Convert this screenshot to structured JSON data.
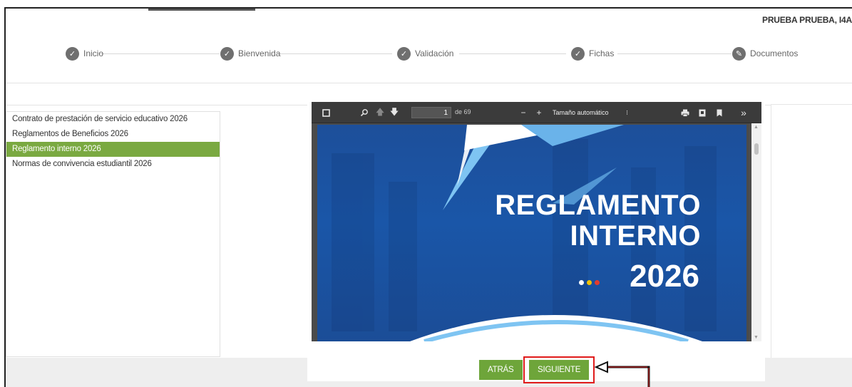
{
  "header": {
    "user_name": "PRUEBA PRUEBA, I4A"
  },
  "steps": [
    {
      "label": "Inicio",
      "icon": "check-icon"
    },
    {
      "label": "Bienvenida",
      "icon": "check-icon"
    },
    {
      "label": "Validación",
      "icon": "check-icon"
    },
    {
      "label": "Fichas",
      "icon": "check-icon"
    },
    {
      "label": "Documentos",
      "icon": "pencil-icon"
    }
  ],
  "documents": [
    {
      "label": "Contrato de prestación de servicio educativo 2026",
      "active": false
    },
    {
      "label": "Reglamentos de Beneficios 2026",
      "active": false
    },
    {
      "label": "Reglamento interno 2026",
      "active": true
    },
    {
      "label": "Normas de convivencia estudiantil 2026",
      "active": false
    }
  ],
  "pdf_viewer": {
    "current_page": "1",
    "page_of": "de 69",
    "zoom_label": "Tamaño automático",
    "page_content": {
      "title_line1": "REGLAMENTO",
      "title_line2": "INTERNO",
      "year": "2026"
    }
  },
  "buttons": {
    "back": "ATRÁS",
    "next": "SIGUIENTE"
  },
  "colors": {
    "accent_green": "#7aa941",
    "button_green": "#6ea53a",
    "step_circle": "#6f6f6f",
    "highlight_red": "#e01b1b",
    "pdf_blue": "#1a56a8"
  }
}
